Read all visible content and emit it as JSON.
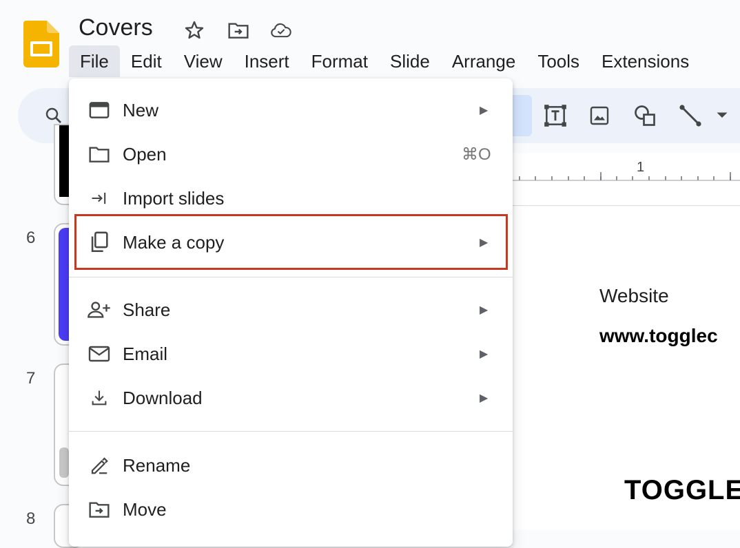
{
  "app": {
    "doc_title": "Covers",
    "brand_color": "#f4b400"
  },
  "menubar": {
    "items": [
      "File",
      "Edit",
      "View",
      "Insert",
      "Format",
      "Slide",
      "Arrange",
      "Tools",
      "Extensions"
    ],
    "active": "File"
  },
  "ruler": {
    "mark_label": "1"
  },
  "filmstrip": {
    "slide_numbers": [
      "6",
      "7",
      "8"
    ]
  },
  "slide": {
    "website_label": "Website",
    "url_text": "www.togglec",
    "brand_text": "TOGGLE"
  },
  "file_menu": {
    "items": [
      {
        "label": "New",
        "icon": "slides-icon",
        "submenu": true
      },
      {
        "label": "Open",
        "icon": "folder-icon",
        "shortcut": "⌘O"
      },
      {
        "label": "Import slides",
        "icon": "import-icon"
      },
      {
        "label": "Make a copy",
        "icon": "copy-icon",
        "submenu": true,
        "highlighted": true
      },
      {
        "label": "Share",
        "icon": "share-person-icon",
        "submenu": true
      },
      {
        "label": "Email",
        "icon": "email-icon",
        "submenu": true
      },
      {
        "label": "Download",
        "icon": "download-icon",
        "submenu": true
      },
      {
        "label": "Rename",
        "icon": "rename-icon"
      },
      {
        "label": "Move",
        "icon": "move-folder-icon"
      }
    ],
    "highlight_color": "#c5391f"
  }
}
